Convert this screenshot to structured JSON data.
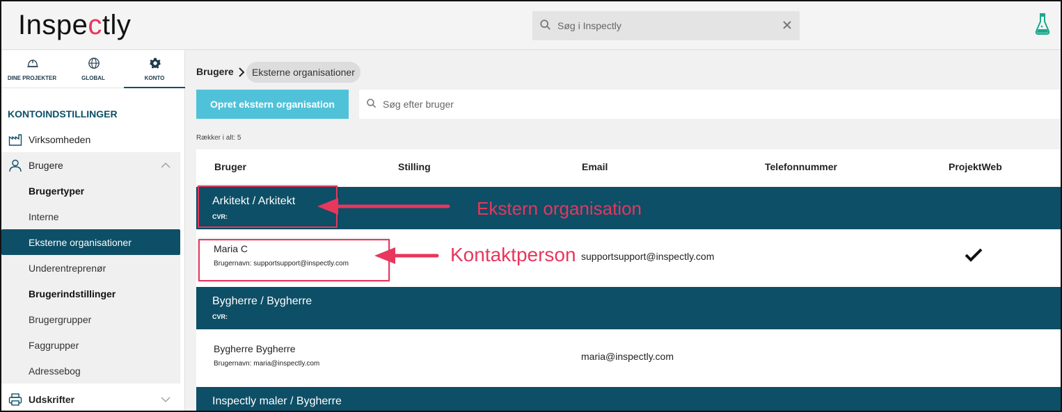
{
  "header": {
    "logo_prefix": "Inspe",
    "logo_accent": "c",
    "logo_suffix": "tly",
    "search_placeholder": "Søg i Inspectly"
  },
  "sidebar": {
    "tabs": [
      {
        "label": "DINE PROJEKTER",
        "icon": "helmet-icon"
      },
      {
        "label": "GLOBAL",
        "icon": "globe-icon"
      },
      {
        "label": "KONTO",
        "icon": "gear-icon",
        "active": true
      }
    ],
    "section_title": "KONTOINDSTILLINGER",
    "items": {
      "virksomheden": "Virksomheden",
      "brugere": "Brugere",
      "brugertyper": "Brugertyper",
      "interne": "Interne",
      "eksterne": "Eksterne organisationer",
      "underentreprenor": "Underentreprenør",
      "brugerindstillinger": "Brugerindstillinger",
      "brugergrupper": "Brugergrupper",
      "faggrupper": "Faggrupper",
      "adressebog": "Adressebog",
      "udskrifter": "Udskrifter"
    }
  },
  "main": {
    "breadcrumb": {
      "parent": "Brugere",
      "current": "Eksterne organisationer"
    },
    "create_button": "Opret ekstern organisation",
    "search_placeholder": "Søg efter bruger",
    "row_count": "Rækker i alt: 5",
    "columns": [
      "Bruger",
      "Stilling",
      "Email",
      "Telefonnummer",
      "ProjektWeb"
    ],
    "groups": [
      {
        "name": "Arkitekt / Arkitekt",
        "cvr": "CVR:",
        "contact": {
          "name": "Maria C",
          "username": "Brugernavn: supportsupport@inspectly.com",
          "email": "supportsupport@inspectly.com",
          "projektweb": true
        }
      },
      {
        "name": "Bygherre / Bygherre",
        "cvr": "CVR:",
        "contact": {
          "name": "Bygherre Bygherre",
          "username": "Brugernavn: maria@inspectly.com",
          "email": "maria@inspectly.com",
          "projektweb": false
        }
      },
      {
        "name": "Inspectly maler / Bygherre",
        "cvr": ""
      }
    ]
  },
  "annotations": {
    "org_label": "Ekstern organisation",
    "contact_label": "Kontaktperson",
    "color": "#e8365d"
  },
  "colors": {
    "brand_dark": "#0d4f66",
    "button_cyan": "#4fc2d9",
    "accent_pink": "#e8365d"
  }
}
